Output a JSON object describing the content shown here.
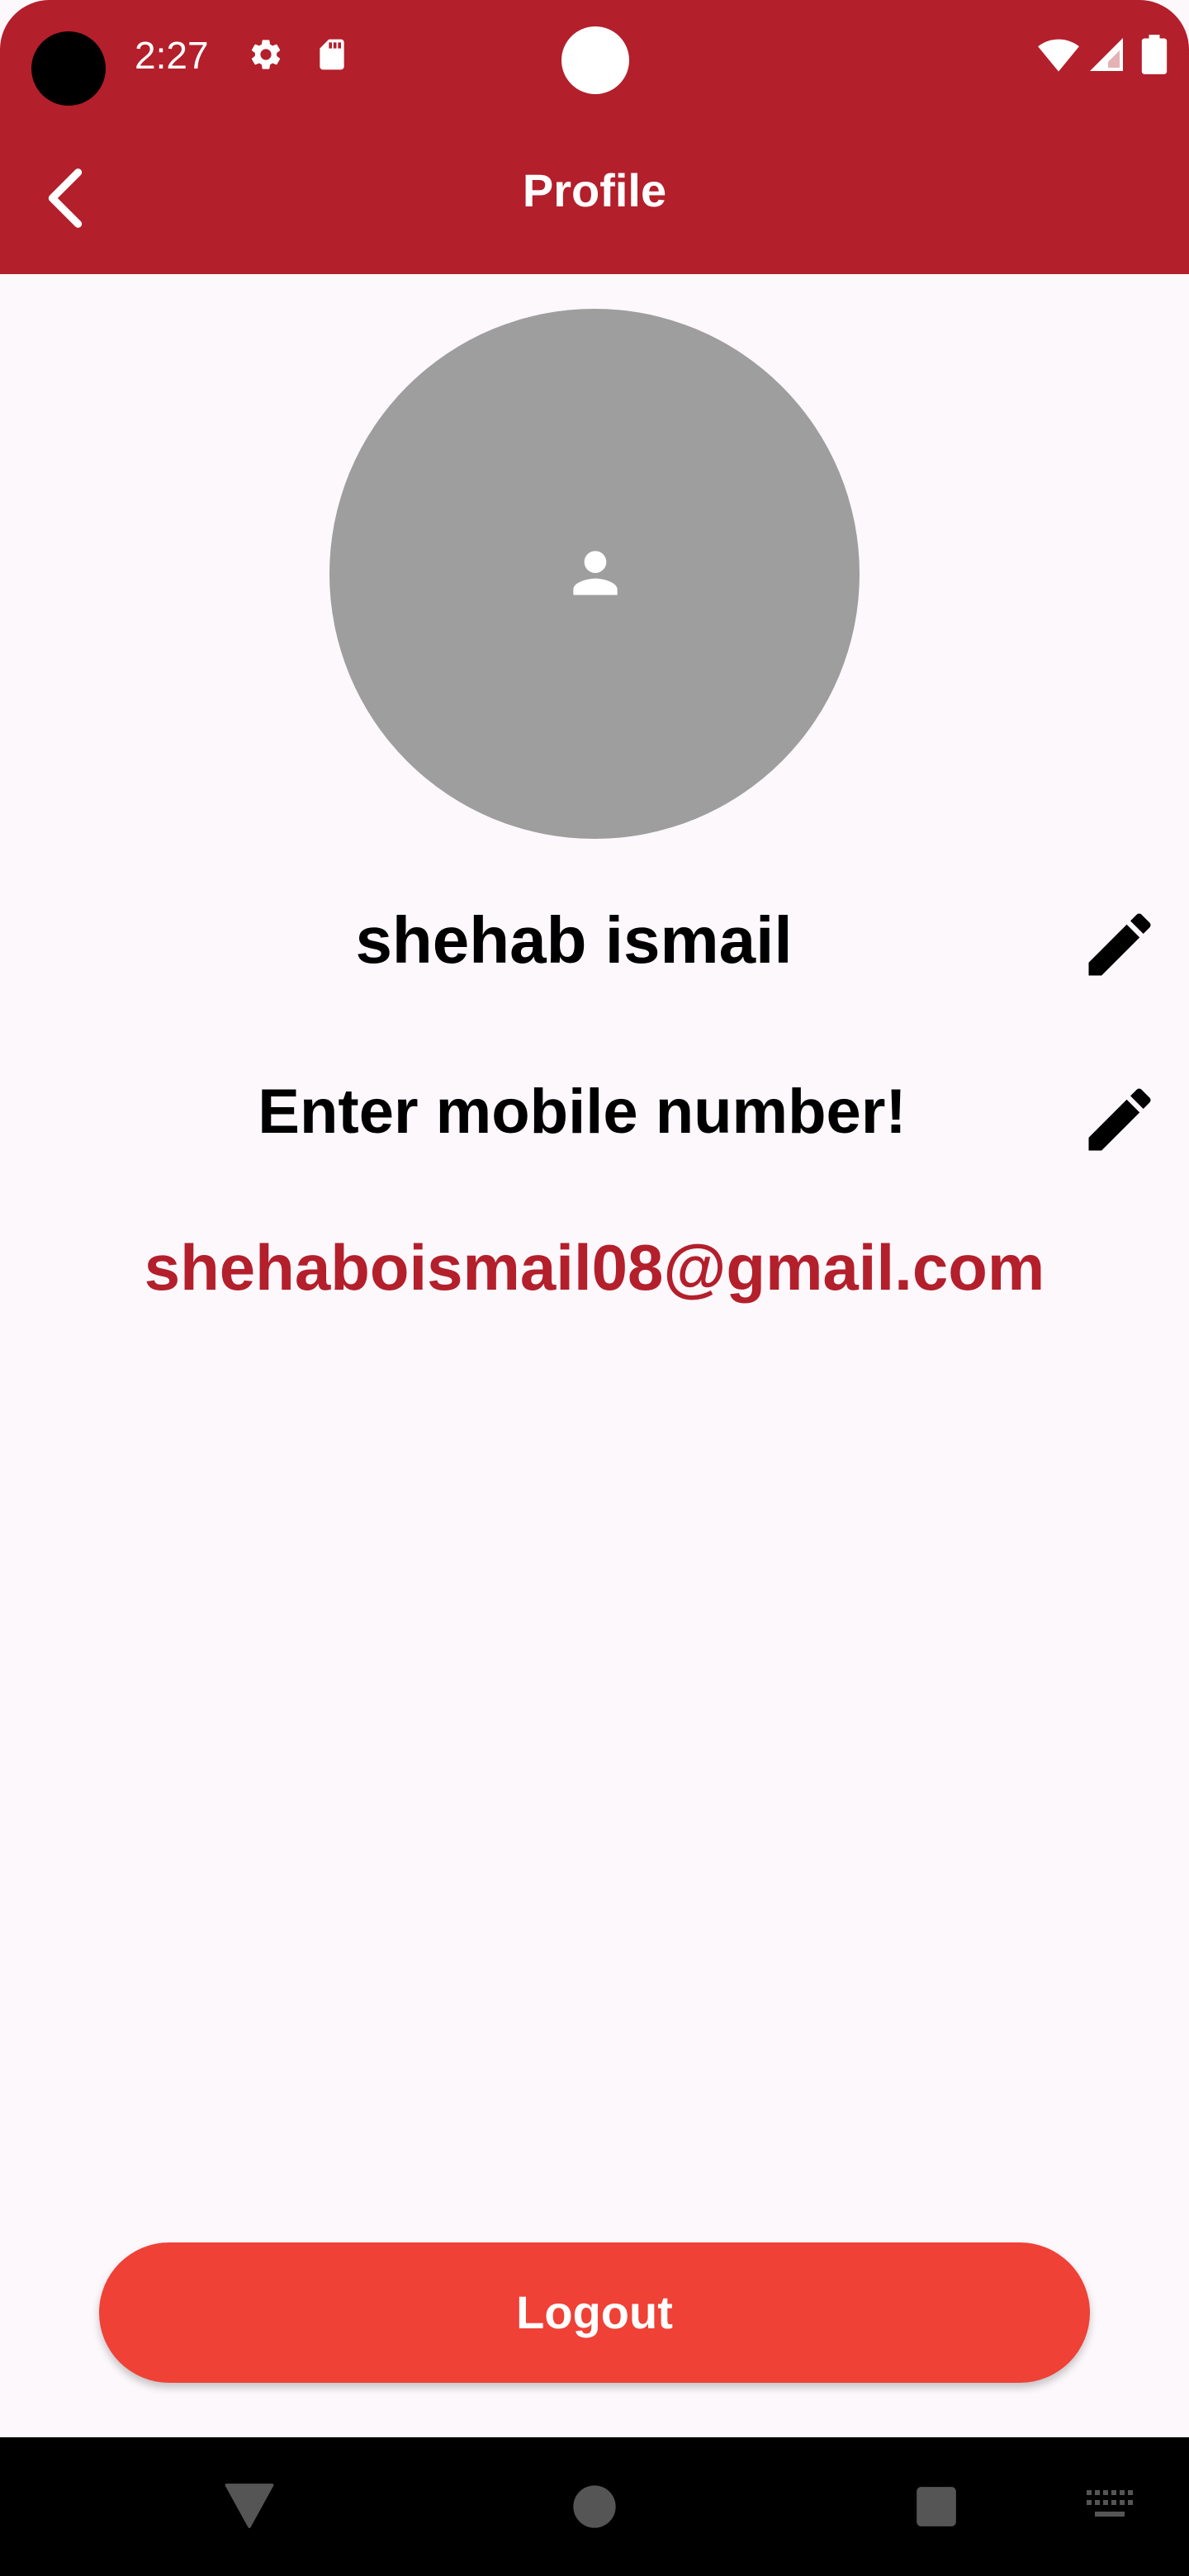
{
  "status_bar": {
    "time": "2:27",
    "icons": [
      "settings-gear-icon",
      "sd-card-icon",
      "wifi-icon",
      "cellular-signal-icon",
      "battery-icon"
    ]
  },
  "app_bar": {
    "title": "Profile",
    "back_icon": "chevron-left-icon"
  },
  "profile": {
    "avatar_icon": "person-icon",
    "name": "shehab ismail",
    "phone": "Enter mobile number!",
    "email": "shehaboismail08@gmail.com",
    "edit_icon": "pencil-icon"
  },
  "actions": {
    "logout_label": "Logout"
  },
  "nav_bar": {
    "icons": [
      "back-triangle-icon",
      "home-circle-icon",
      "recents-square-icon",
      "keyboard-icon"
    ]
  },
  "colors": {
    "primary": "#b31f2b",
    "logout": "#ef4136",
    "avatar_bg": "#9e9e9e",
    "background": "#fdf8fc"
  }
}
